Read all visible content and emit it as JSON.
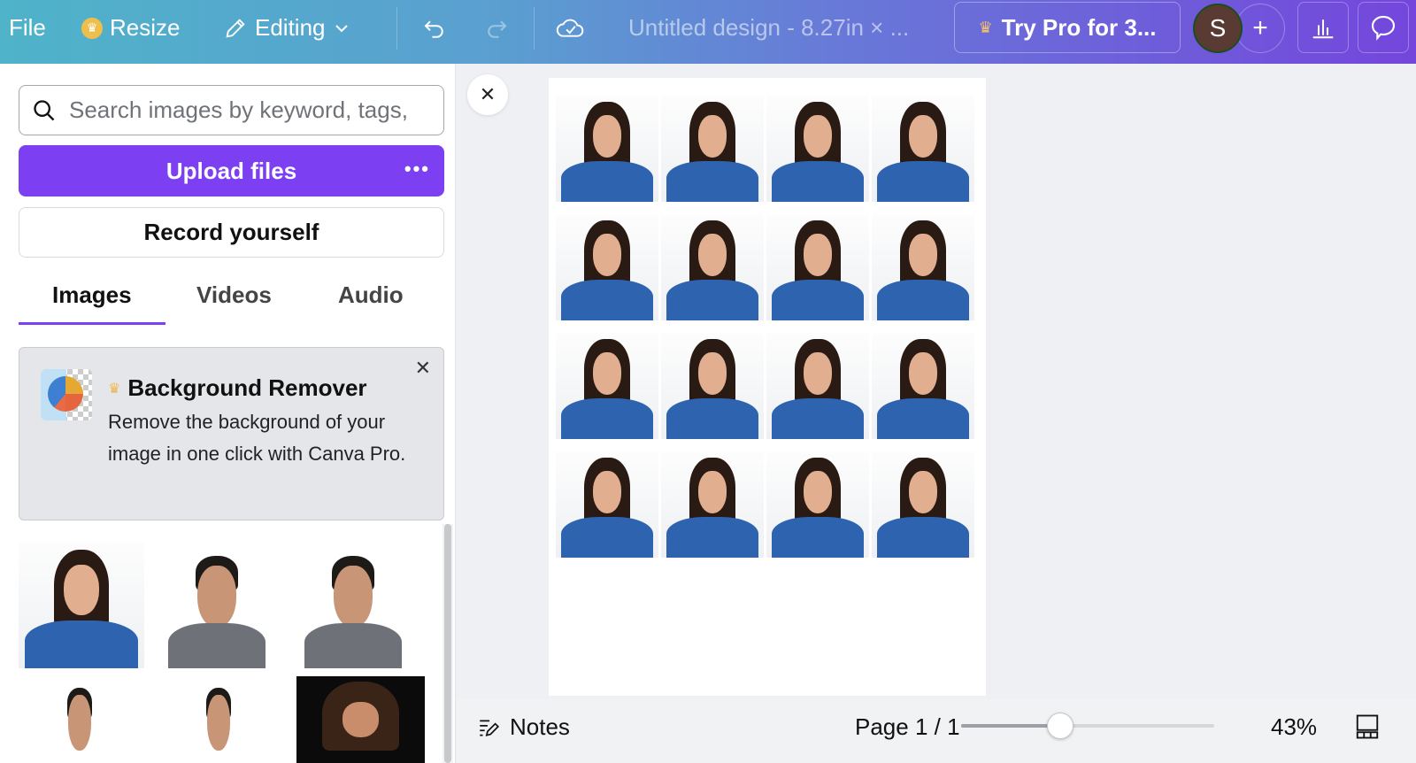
{
  "topbar": {
    "file": "File",
    "resize": "Resize",
    "editing": "Editing",
    "title": "Untitled design - 8.27in × ...",
    "try_pro": "Try Pro for 3...",
    "avatar_initial": "S",
    "add": "+"
  },
  "panel": {
    "search_placeholder": "Search images by keyword, tags,",
    "upload_label": "Upload files",
    "upload_more": "•••",
    "record_label": "Record yourself",
    "tabs": [
      {
        "label": "Images",
        "active": true
      },
      {
        "label": "Videos",
        "active": false
      },
      {
        "label": "Audio",
        "active": false
      }
    ],
    "promo": {
      "title": "Background Remover",
      "text": "Remove the background of your image in one click with Canva Pro."
    },
    "thumbnails": [
      {
        "subject": "woman-blue-shirt"
      },
      {
        "subject": "man-gray-sweater"
      },
      {
        "subject": "man-gray-sweater"
      },
      {
        "subject": "man-face-crop"
      },
      {
        "subject": "man-face-crop"
      },
      {
        "subject": "woman-dark-background"
      }
    ]
  },
  "canvas": {
    "rows": 4,
    "cols": 4,
    "photo_subject": "woman-blue-shirt"
  },
  "footer": {
    "notes": "Notes",
    "page": "Page 1 / 1",
    "zoom_percent": 43,
    "zoom_label": "43%",
    "zoom_slider_fraction": 0.39
  },
  "colors": {
    "accent": "#7d3ff2",
    "crown": "#f0be4a"
  }
}
